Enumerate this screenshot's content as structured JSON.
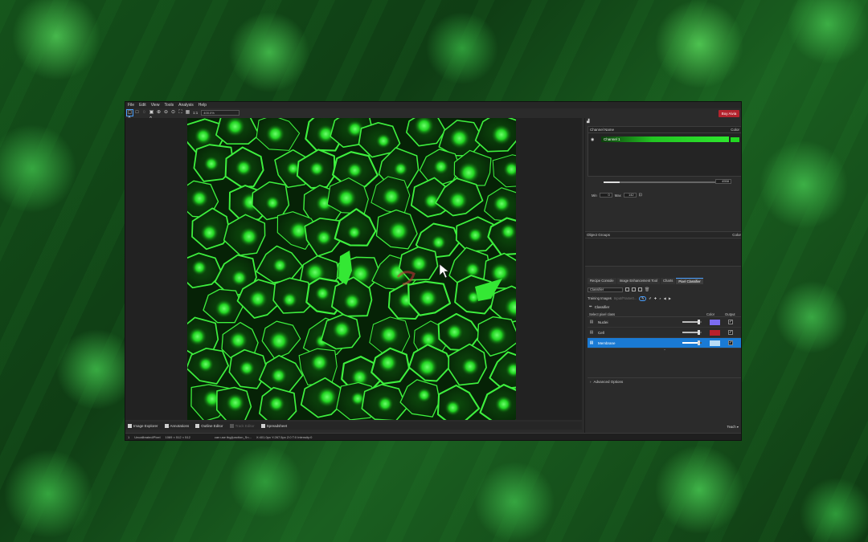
{
  "menu": [
    "File",
    "Edit",
    "View",
    "Tools",
    "Analysis",
    "Help"
  ],
  "buy_label": "Buy Aivia",
  "toolbar": {
    "icons": [
      "select-icon",
      "rectangle-icon",
      "lasso-icon",
      "capture-icon",
      "zoom-in-icon",
      "zoom-out-icon",
      "zoom-reset-icon",
      "fit-icon",
      "grid-icon"
    ],
    "ratio_label": "1:1",
    "zoom_value": "400.0%"
  },
  "nav_arrows": [
    "up-arrow-icon",
    "down-arrow-icon",
    "down-arrow-icon",
    "up-arrow-icon"
  ],
  "bottom_tabs": [
    {
      "label": "Image Explorer",
      "enabled": true
    },
    {
      "label": "Annotations",
      "enabled": true
    },
    {
      "label": "Outline Editor",
      "enabled": true
    },
    {
      "label": "Track Editor",
      "enabled": false
    },
    {
      "label": "Spreadsheet",
      "enabled": true
    }
  ],
  "status": {
    "zoom": "1",
    "calibration": "Uncalibrated/Pixel",
    "dims": "1069 × 512 × 512",
    "hint": "can use tbg/junction_Sn...",
    "coords": "X:401.0px  Y:267.5px  Z:0  T:0  Intensity:0"
  },
  "channels": {
    "header_name": "Channel Name",
    "header_color": "Color",
    "items": [
      {
        "name": "Channel 1",
        "color": "#22d822"
      }
    ],
    "max_value": "4558",
    "min_label": "Min",
    "min_value": "0",
    "max_label": "Max",
    "max_field": "142",
    "slider_fraction": 0.13
  },
  "object_groups": {
    "header": "Object Groups",
    "color_header": "Color"
  },
  "panel_tabs": [
    {
      "label": "Recipe Console",
      "active": false
    },
    {
      "label": "Image Enhancement Tool",
      "active": false
    },
    {
      "label": "Charts",
      "active": false
    },
    {
      "label": "Pixel Classifier",
      "active": true
    }
  ],
  "classifier": {
    "dropdown_label": "Classifier",
    "training_label": "Training Images",
    "training_placeholder": "Input/Frame0...",
    "section_label": "Classifier",
    "table_header": "Select pixel class",
    "color_header": "Color",
    "output_header": "Output",
    "classes": [
      {
        "name": "Nuclei",
        "color": "#7b6cf2",
        "opacity": 0.8,
        "output": true,
        "selected": false
      },
      {
        "name": "Cell",
        "color": "#b8202c",
        "opacity": 0.8,
        "output": true,
        "selected": false
      },
      {
        "name": "Membrane",
        "color": "#b9dcf5",
        "opacity": 0.8,
        "output": true,
        "selected": true
      }
    ],
    "advanced_label": "Advanced Options",
    "teach_label": "Teach"
  }
}
